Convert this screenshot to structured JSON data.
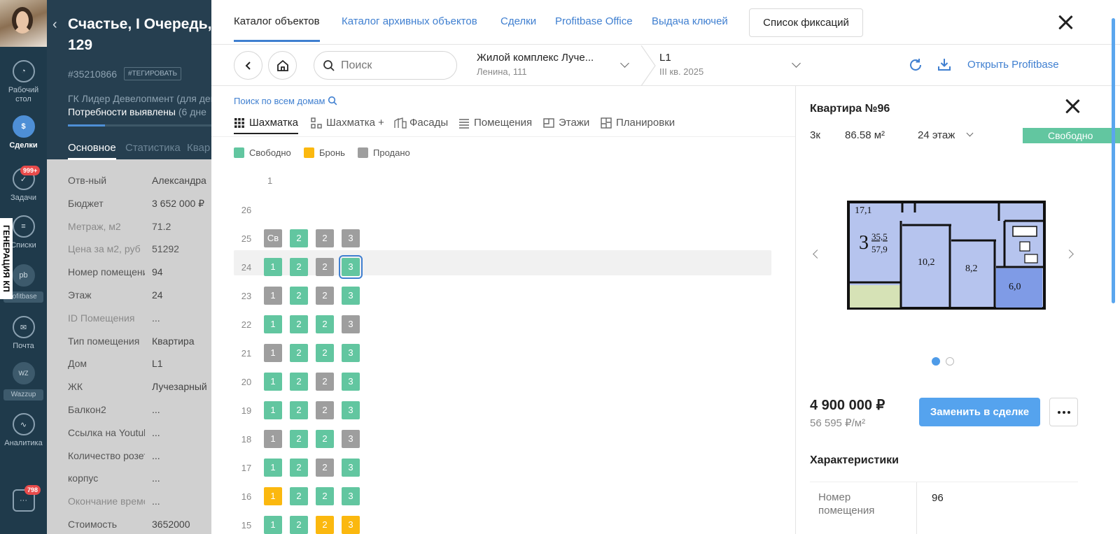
{
  "rail": {
    "items": [
      {
        "label": "Рабочий стол",
        "icon": "dashboard-icon"
      },
      {
        "label": "Сделки",
        "icon": "deals-icon"
      },
      {
        "label": "Задачи",
        "icon": "tasks-icon",
        "badge": "999+"
      },
      {
        "label": "Списки",
        "icon": "lists-icon"
      },
      {
        "label": "Почта",
        "icon": "mail-icon"
      },
      {
        "label": "Аналитика",
        "icon": "analytics-icon"
      }
    ],
    "profitbase_label": "rofitbase",
    "wazzup_label": "Wazzup",
    "chat_badge": "798",
    "generation_tab": "ГЕНЕРАЦИЯ КП"
  },
  "deal": {
    "title_line1": "Счастье, I Очередь, эт",
    "title_line2": "129",
    "id": "#35210866",
    "tag": "#ТЕГИРОВАТЬ",
    "company": "ГК Лидер Девелопмент (для демо",
    "stage": "Потребности выявлены",
    "stage_suffix": "(6 дне",
    "stage_progress": 0.26,
    "tabs": [
      "Основное",
      "Статистика",
      "Квар"
    ],
    "fields": [
      {
        "label": "Отв-ный",
        "value": "Александра"
      },
      {
        "label": "Бюджет",
        "value": "3 652 000 ₽"
      },
      {
        "label": "Метраж, м2",
        "value": "71.2"
      },
      {
        "label": "Цена за м2, руб",
        "value": "51292"
      },
      {
        "label": "Номер помещения",
        "value": "94"
      },
      {
        "label": "Этаж",
        "value": "24"
      },
      {
        "label": "ID Помещения",
        "value": "..."
      },
      {
        "label": "Тип помещения",
        "value": "Квартира"
      },
      {
        "label": "Дом",
        "value": "L1"
      },
      {
        "label": "ЖК",
        "value": "Лучезарный"
      },
      {
        "label": "Балкон2",
        "value": "..."
      },
      {
        "label": "Ссылка на Youtube",
        "value": "..."
      },
      {
        "label": "Количество розеток",
        "value": "..."
      },
      {
        "label": "корпус",
        "value": "..."
      },
      {
        "label": "Окончание времени",
        "value": "..."
      },
      {
        "label": "Стоимость",
        "value": "3652000"
      }
    ]
  },
  "topnav": {
    "links": [
      "Каталог объектов",
      "Каталог архивных объектов",
      "Сделки",
      "Profitbase Office",
      "Выдача ключей"
    ],
    "fixations_button": "Список фиксаций"
  },
  "toolbar": {
    "search_placeholder": "Поиск",
    "complex_name": "Жилой комплекс Луче...",
    "complex_address": "Ленина, 111",
    "house_name": "L1",
    "house_deadline": "III кв. 2025",
    "open_profitbase": "Открыть Profitbase"
  },
  "catalog": {
    "search_all_houses": "Поиск по всем домам",
    "view_tabs": [
      "Шахматка",
      "Шахматка +",
      "Фасады",
      "Помещения",
      "Этажи",
      "Планировки"
    ],
    "legend": [
      {
        "label": "Свободно",
        "color": "#62c6a0"
      },
      {
        "label": "Бронь",
        "color": "#fbb80f"
      },
      {
        "label": "Продано",
        "color": "#9e9e9e"
      }
    ],
    "section_header": "1",
    "selected_floor": "24",
    "floors": [
      {
        "floor": "26",
        "cells": []
      },
      {
        "floor": "25",
        "cells": [
          [
            "Св",
            "sold"
          ],
          [
            "2",
            "free"
          ],
          [
            "2",
            "sold"
          ],
          [
            "3",
            "sold"
          ]
        ]
      },
      {
        "floor": "24",
        "cells": [
          [
            "1",
            "free"
          ],
          [
            "2",
            "free"
          ],
          [
            "2",
            "sold"
          ],
          [
            "3",
            "free-selected"
          ]
        ]
      },
      {
        "floor": "23",
        "cells": [
          [
            "1",
            "sold"
          ],
          [
            "2",
            "free"
          ],
          [
            "2",
            "sold"
          ],
          [
            "3",
            "free"
          ]
        ]
      },
      {
        "floor": "22",
        "cells": [
          [
            "1",
            "free"
          ],
          [
            "2",
            "free"
          ],
          [
            "2",
            "free"
          ],
          [
            "3",
            "sold"
          ]
        ]
      },
      {
        "floor": "21",
        "cells": [
          [
            "1",
            "sold"
          ],
          [
            "2",
            "free"
          ],
          [
            "2",
            "free"
          ],
          [
            "3",
            "free"
          ]
        ]
      },
      {
        "floor": "20",
        "cells": [
          [
            "1",
            "free"
          ],
          [
            "2",
            "free"
          ],
          [
            "2",
            "sold"
          ],
          [
            "3",
            "free"
          ]
        ]
      },
      {
        "floor": "19",
        "cells": [
          [
            "1",
            "free"
          ],
          [
            "2",
            "free"
          ],
          [
            "2",
            "sold"
          ],
          [
            "3",
            "free"
          ]
        ]
      },
      {
        "floor": "18",
        "cells": [
          [
            "1",
            "sold"
          ],
          [
            "2",
            "free"
          ],
          [
            "2",
            "free"
          ],
          [
            "3",
            "sold"
          ]
        ]
      },
      {
        "floor": "17",
        "cells": [
          [
            "1",
            "free"
          ],
          [
            "2",
            "free"
          ],
          [
            "2",
            "sold"
          ],
          [
            "3",
            "free"
          ]
        ]
      },
      {
        "floor": "16",
        "cells": [
          [
            "1",
            "booked"
          ],
          [
            "2",
            "free"
          ],
          [
            "2",
            "free"
          ],
          [
            "3",
            "free"
          ]
        ]
      },
      {
        "floor": "15",
        "cells": [
          [
            "1",
            "free"
          ],
          [
            "2",
            "free"
          ],
          [
            "2",
            "booked"
          ],
          [
            "3",
            "booked"
          ]
        ]
      }
    ]
  },
  "apartment": {
    "title": "Квартира №96",
    "rooms": "3к",
    "area": "86.58 м²",
    "floor": "24 этаж",
    "status": "Свободно",
    "plan_labels": [
      "17,1",
      "3",
      "35,5",
      "57,9",
      "10,2",
      "8,2",
      "6,0"
    ],
    "price": "4 900 000 ₽",
    "price_per_m2": "56 595 ₽/м²",
    "replace_button": "Заменить в сделке",
    "characteristics_title": "Характеристики",
    "characteristics": [
      {
        "key": "Номер помещения",
        "value": "96"
      }
    ]
  }
}
